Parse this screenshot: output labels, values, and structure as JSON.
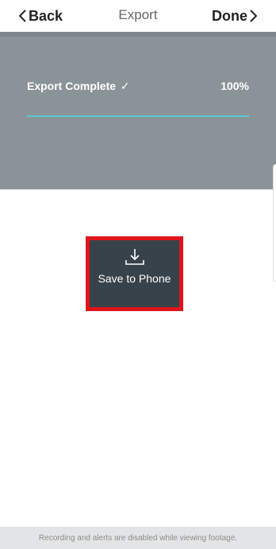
{
  "nav": {
    "back_label": "Back",
    "title": "Export",
    "done_label": "Done",
    "back_icon": "chevron-left-icon",
    "done_icon": "chevron-right-icon"
  },
  "export_status": {
    "label": "Export Complete",
    "check_glyph": "✓",
    "percent_text": "100%",
    "progress_fraction": 1.0
  },
  "action": {
    "save_label": "Save to Phone",
    "icon": "download-icon"
  },
  "footer": {
    "message": "Recording and alerts are disabled while viewing footage."
  },
  "colors": {
    "panel_bg": "#8a9398",
    "progress_fill": "#5ac8d2",
    "highlight": "#e0141a",
    "button_bg": "#38424a",
    "footer_bg": "#e3e4e5"
  }
}
